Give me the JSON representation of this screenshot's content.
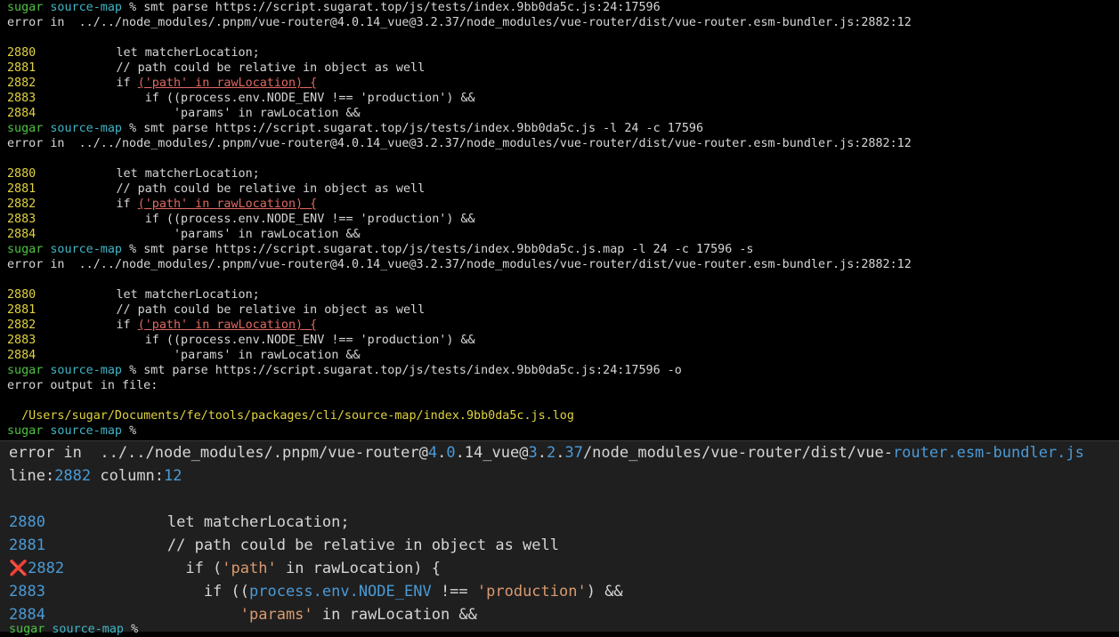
{
  "prompt": {
    "user": "sugar",
    "dir": "source-map",
    "symbol": "%"
  },
  "commands": [
    {
      "cmd": "smt parse https://script.sugarat.top/js/tests/index.9bb0da5c.js:24:17596",
      "error": "error in  ../../node_modules/.pnpm/vue-router@4.0.14_vue@3.2.37/node_modules/vue-router/dist/vue-router.esm-bundler.js:2882:12"
    },
    {
      "cmd": "smt parse https://script.sugarat.top/js/tests/index.9bb0da5c.js -l 24 -c 17596",
      "error": "error in  ../../node_modules/.pnpm/vue-router@4.0.14_vue@3.2.37/node_modules/vue-router/dist/vue-router.esm-bundler.js:2882:12"
    },
    {
      "cmd": "smt parse https://script.sugarat.top/js/tests/index.9bb0da5c.js.map -l 24 -c 17596 -s",
      "error": "error in  ../../node_modules/.pnpm/vue-router@4.0.14_vue@3.2.37/node_modules/vue-router/dist/vue-router.esm-bundler.js:2882:12"
    },
    {
      "cmd": "smt parse https://script.sugarat.top/js/tests/index.9bb0da5c.js:24:17596 -o",
      "output_label": "error output in file:",
      "output_file": "/Users/sugar/Documents/fe/tools/packages/cli/source-map/index.9bb0da5c.js.log"
    }
  ],
  "code": {
    "lines": [
      {
        "num": "2880",
        "pre": "        let matcherLocation;",
        "hl": "",
        "post": ""
      },
      {
        "num": "2881",
        "pre": "        // path could be relative in object as well",
        "hl": "",
        "post": ""
      },
      {
        "num": "2882",
        "pre": "        if ",
        "hl": "('path' in rawLocation) {",
        "post": ""
      },
      {
        "num": "2883",
        "pre": "            if ((process.env.NODE_ENV !== 'production') &&",
        "hl": "",
        "post": ""
      },
      {
        "num": "2884",
        "pre": "                'params' in rawLocation &&",
        "hl": "",
        "post": ""
      }
    ]
  },
  "overlay": {
    "error_prefix": "error in  ../../node_modules/.pnpm/vue-router@",
    "v1a": "4",
    "dot1": ".",
    "v1b": "0",
    "v1c": ".14_vue@",
    "v2a": "3",
    "dot2": ".",
    "v2b": "2",
    "v2c": ".",
    "v2d": "37",
    "path_mid": "/node_modules/vue-router/dist/vue-",
    "file_tail": "router.esm-bundler.js",
    "line_label": "line:",
    "line_val": "2882",
    "col_label": " column:",
    "col_val": "12",
    "error_marker": "❌",
    "rows": [
      {
        "num": "2880",
        "text": "        let matcherLocation;"
      },
      {
        "num": "2881",
        "text": "        // path could be relative in object as well"
      },
      {
        "num": "2882",
        "a": "          if (",
        "s": "'path'",
        "b": " in rawLocation) {"
      },
      {
        "num": "2883",
        "a": "            if ((",
        "k": "process.env.NODE_ENV",
        "b": " !== ",
        "s": "'production'",
        "c": ") &&"
      },
      {
        "num": "2884",
        "a": "                ",
        "s": "'params'",
        "b": " in rawLocation &&"
      }
    ]
  }
}
